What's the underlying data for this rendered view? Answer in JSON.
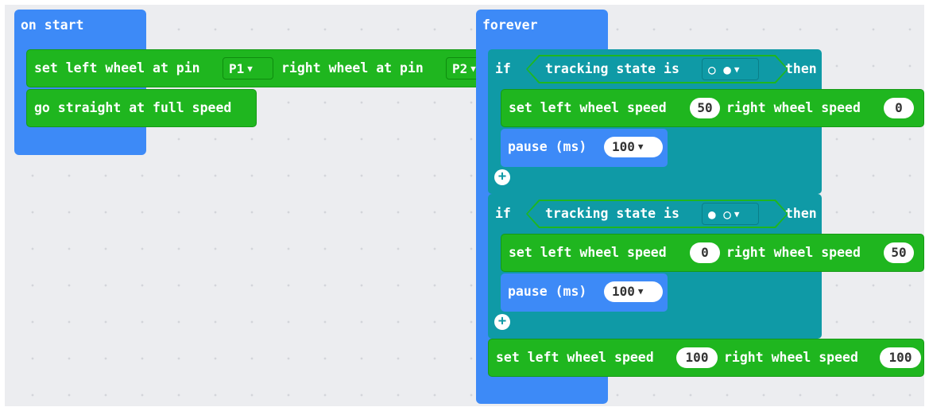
{
  "on_start": {
    "label": "on start",
    "set_wheels": {
      "left_label": "set left wheel at pin",
      "left_pin": "P1",
      "right_label": "right wheel at pin",
      "right_pin": "P2"
    },
    "go_straight": "go straight at full speed"
  },
  "forever": {
    "label": "forever",
    "if1": {
      "if_label": "if",
      "cond_label": "tracking state is",
      "state": "○ ●",
      "then_label": "then",
      "speed": {
        "left_label": "set left wheel speed",
        "left": "50",
        "right_label": "right wheel speed",
        "right": "0"
      },
      "pause": {
        "label": "pause (ms)",
        "value": "100"
      }
    },
    "if2": {
      "if_label": "if",
      "cond_label": "tracking state is",
      "state": "● ○",
      "then_label": "then",
      "speed": {
        "left_label": "set left wheel speed",
        "left": "0",
        "right_label": "right wheel speed",
        "right": "50"
      },
      "pause": {
        "label": "pause (ms)",
        "value": "100"
      }
    },
    "final_speed": {
      "left_label": "set left wheel speed",
      "left": "100",
      "right_label": "right wheel speed",
      "right": "100"
    }
  },
  "colors": {
    "event_blue": "#3d8af7",
    "motor_green": "#1fb61f",
    "logic_teal": "#0f9aa6",
    "workspace": "#ecedf0"
  },
  "icons": {
    "add": "plus-circle-icon",
    "dropdown": "caret-down-icon"
  }
}
